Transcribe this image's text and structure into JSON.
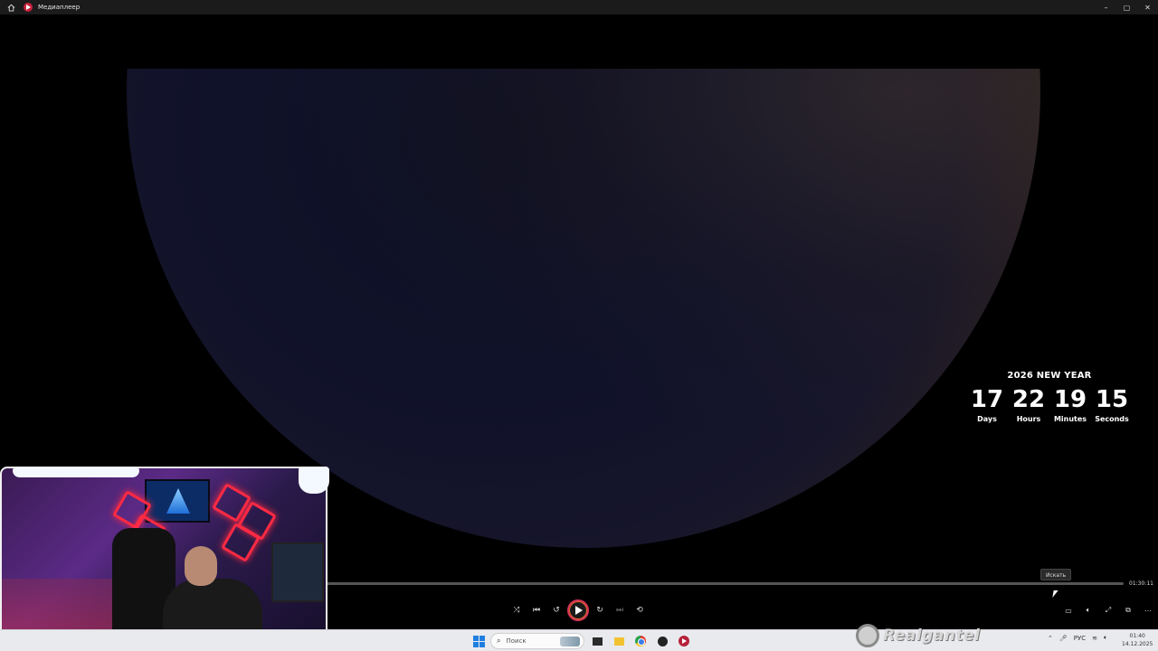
{
  "window": {
    "title": "Медиаплеер",
    "controls": [
      "–",
      "▢",
      "✕"
    ]
  },
  "video": {
    "countdown": {
      "title": "2026 NEW YEAR",
      "units": [
        {
          "value": "17",
          "label": "Days"
        },
        {
          "value": "22",
          "label": "Hours"
        },
        {
          "value": "19",
          "label": "Minutes"
        },
        {
          "value": "15",
          "label": "Seconds"
        }
      ]
    }
  },
  "player": {
    "duration": "01:30:11",
    "progress": 0,
    "tooltip": "Искать",
    "controls": {
      "shuffle_icon": "shuffle-icon",
      "previous_icon": "previous-icon",
      "rewind_icon": "rewind-10-icon",
      "play_icon": "play-icon",
      "forward_icon": "forward-30-icon",
      "next_icon": "next-icon",
      "repeat_icon": "repeat-icon"
    },
    "right_controls": [
      "subtitles-icon",
      "volume-icon",
      "fullscreen-icon",
      "mini-player-icon",
      "more-icon"
    ],
    "accent_color": "#d63358"
  },
  "taskbar": {
    "search_placeholder": "Поиск",
    "language": "РУС",
    "time": "01:40",
    "date": "14.12.2025"
  },
  "overlay": {
    "watermark": "Realgantel"
  }
}
